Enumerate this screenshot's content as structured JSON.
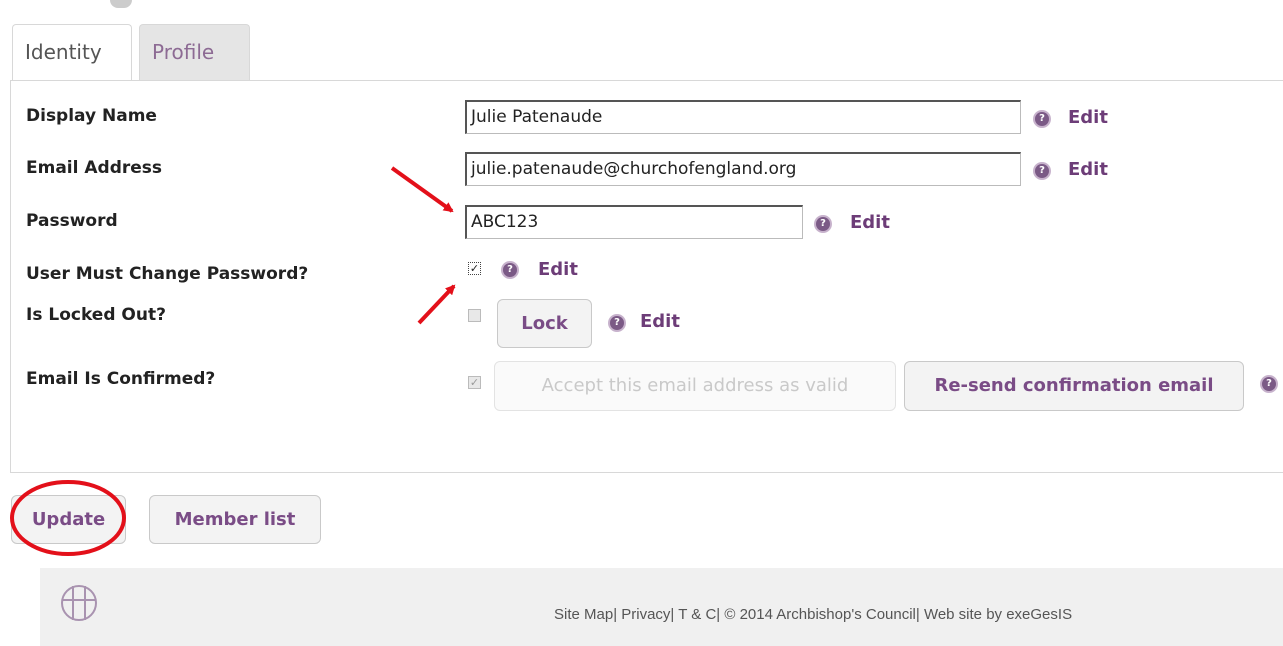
{
  "tabs": [
    {
      "label": "Identity",
      "active": true
    },
    {
      "label": "Profile",
      "active": false
    }
  ],
  "form": {
    "display_name": {
      "label": "Display Name",
      "value": "Julie Patenaude",
      "edit": "Edit"
    },
    "email": {
      "label": "Email Address",
      "value": "julie.patenaude@churchofengland.org",
      "edit": "Edit"
    },
    "password": {
      "label": "Password",
      "value": "ABC123",
      "edit": "Edit"
    },
    "must_change_password": {
      "label": "User Must Change Password?",
      "checked": true,
      "edit": "Edit"
    },
    "locked_out": {
      "label": "Is Locked Out?",
      "checked": false,
      "lock_button": "Lock",
      "edit": "Edit"
    },
    "email_confirmed": {
      "label": "Email Is Confirmed?",
      "checked": true,
      "accept_button": "Accept this email address as valid",
      "resend_button": "Re-send confirmation email"
    }
  },
  "actions": {
    "update": "Update",
    "member_list": "Member list"
  },
  "footer": {
    "text": "Site Map| Privacy| T & C| © 2014 Archbishop's Council| Web site by exeGesIS"
  },
  "colors": {
    "accent": "#6d3d78",
    "annotation": "#e3101a",
    "footer_bg": "#f0f0f0"
  },
  "icons": {
    "help": "question-circle-icon",
    "logo": "cross-circle-logo"
  }
}
